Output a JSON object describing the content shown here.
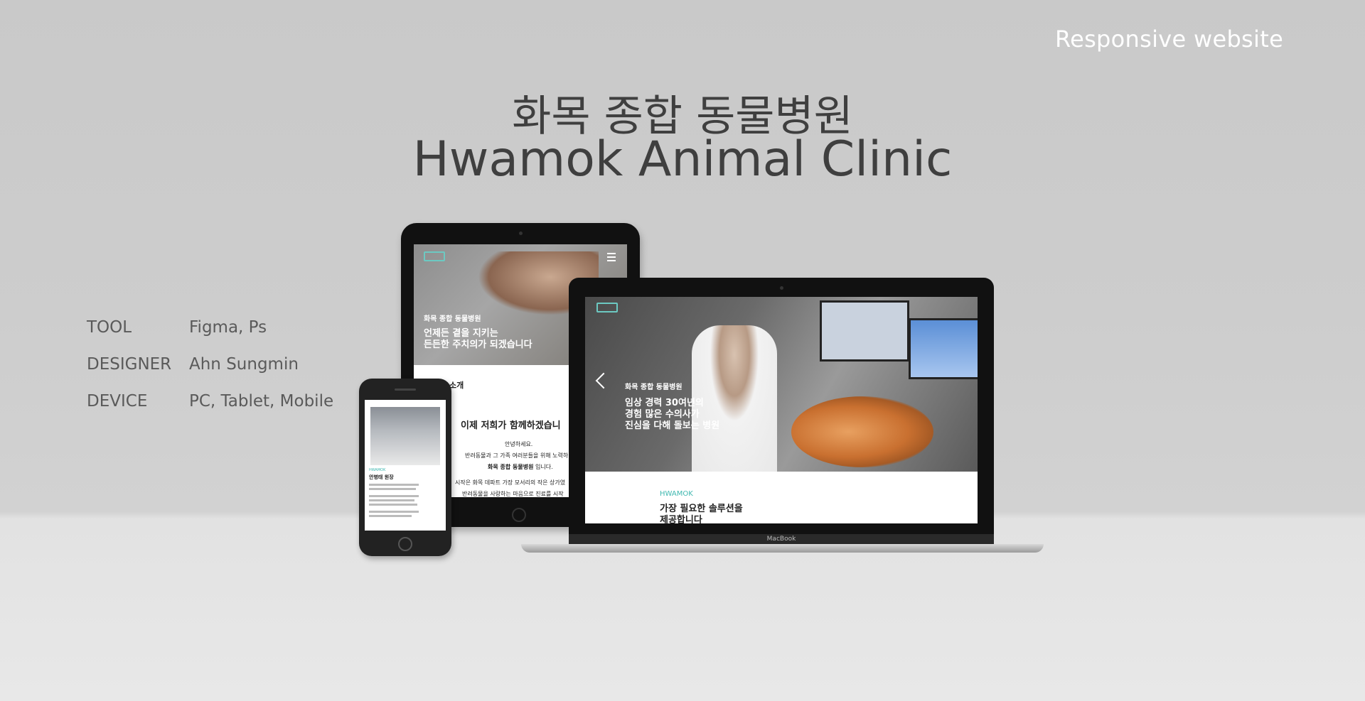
{
  "tagline": "Responsive website",
  "title_kr": "화목 종합 동물병원",
  "title_en": "Hwamok Animal Clinic",
  "meta": [
    {
      "key": "TOOL",
      "value": "Figma, Ps"
    },
    {
      "key": "DESIGNER",
      "value": "Ahn Sungmin"
    },
    {
      "key": "DEVICE",
      "value": "PC, Tablet, Mobile"
    }
  ],
  "tablet": {
    "clinic_name": "화목 종합 동물병원",
    "hero_line1": "언제든 곁을 지키는",
    "hero_line2": "든든한 주치의가 되겠습니다",
    "section_title": "소개",
    "heading": "이제 저희가 함께하겠습니",
    "greeting": "안녕하세요.",
    "body1": "반려동물과 그 가족 여러분들을 위해 노력하",
    "body2_bold": "화목 종합 동물병원",
    "body2_rest": " 입니다.",
    "body3": "시작은 화목 데파트 가장 모서리의 작은 상가였",
    "body4": "반려동물을 사랑하는 마음으로 진료를 시작"
  },
  "laptop": {
    "clinic_name": "화목 종합 동물병원",
    "hero_line1": "임상 경력 30여년의",
    "hero_line2": "경험 많은 수의사가",
    "hero_line3": "진심을 다해 돌보는 병원",
    "section_tag": "HWAMOK",
    "section_line1": "가장 필요한 솔루션을",
    "section_line2": "제공합니다",
    "brand": "MacBook"
  },
  "phone": {
    "section_tag": "HWAMOK",
    "name": "안병태 원장"
  },
  "colors": {
    "accent": "#3fb8b0",
    "title": "#3f3f3f"
  }
}
